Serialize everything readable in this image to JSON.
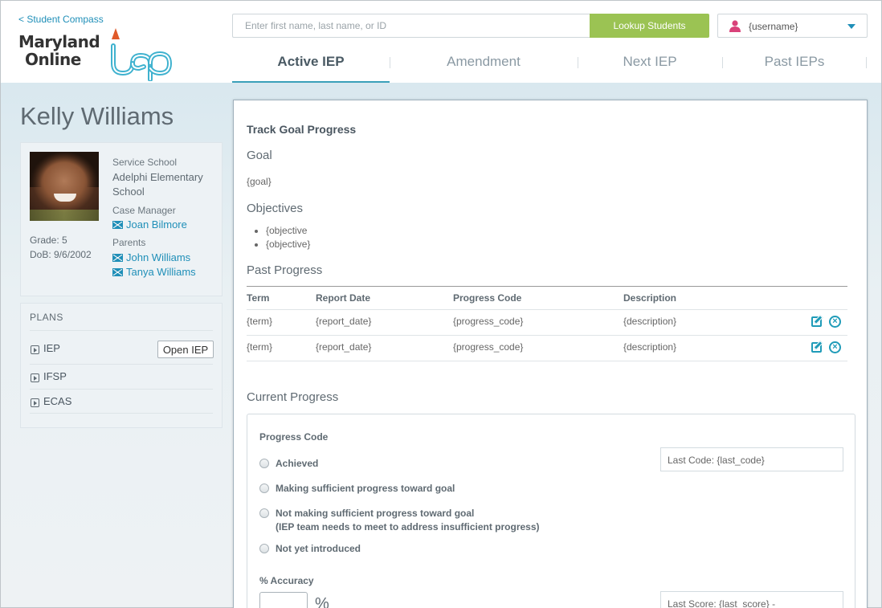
{
  "header": {
    "back_link": "< Student Compass",
    "logo_line1": "Maryland",
    "logo_line2": "Online",
    "logo_mark": "IEP",
    "search_placeholder": "Enter first name, last name, or ID",
    "lookup_label": "Lookup Students",
    "username": "{username}",
    "tabs": [
      {
        "label": "Active IEP",
        "active": true
      },
      {
        "label": "Amendment",
        "active": false
      },
      {
        "label": "Next IEP",
        "active": false
      },
      {
        "label": "Past IEPs",
        "active": false
      }
    ]
  },
  "student": {
    "name": "Kelly Williams",
    "grade": "Grade:  5",
    "dob": "DoB:  9/6/2002",
    "service_school_label": "Service School",
    "service_school": "Adelphi Elementary School",
    "case_manager_label": "Case Manager",
    "case_manager": "Joan Bilmore",
    "parents_label": "Parents",
    "parents": [
      "John Williams",
      "Tanya Williams"
    ]
  },
  "plans": {
    "title": "PLANS",
    "items": [
      "IEP",
      "IFSP",
      "ECAS"
    ],
    "open_label": "Open IEP"
  },
  "main": {
    "title": "Track Goal Progress",
    "goal_heading": "Goal",
    "goal_value": "{goal}",
    "objectives_heading": "Objectives",
    "objectives": [
      "{objective",
      "{objective}"
    ],
    "past_heading": "Past Progress",
    "table": {
      "headers": [
        "Term",
        "Report Date",
        "Progress Code",
        "Description"
      ],
      "rows": [
        [
          "{term}",
          "{report_date}",
          "{progress_code}",
          "{description}"
        ],
        [
          "{term}",
          "{report_date}",
          "{progress_code}",
          "{description}"
        ]
      ]
    },
    "current_heading": "Current Progress",
    "progress_code_label": "Progress Code",
    "options": [
      "Achieved",
      "Making sufficient progress toward goal",
      "Not making sufficient progress toward goal",
      "Not yet introduced"
    ],
    "option_note": "(IEP team needs to meet to address insufficient progress)",
    "last_code": "Last Code: {last_code}",
    "accuracy_label": "% Accuracy",
    "pct_symbol": "%",
    "last_score": "Last Score: {last_score} -"
  },
  "colors": {
    "accent": "#1f8fb8",
    "lookup_button": "#9bc353",
    "active_tab_underline": "#3aa0b9",
    "user_icon": "#d9427a"
  }
}
